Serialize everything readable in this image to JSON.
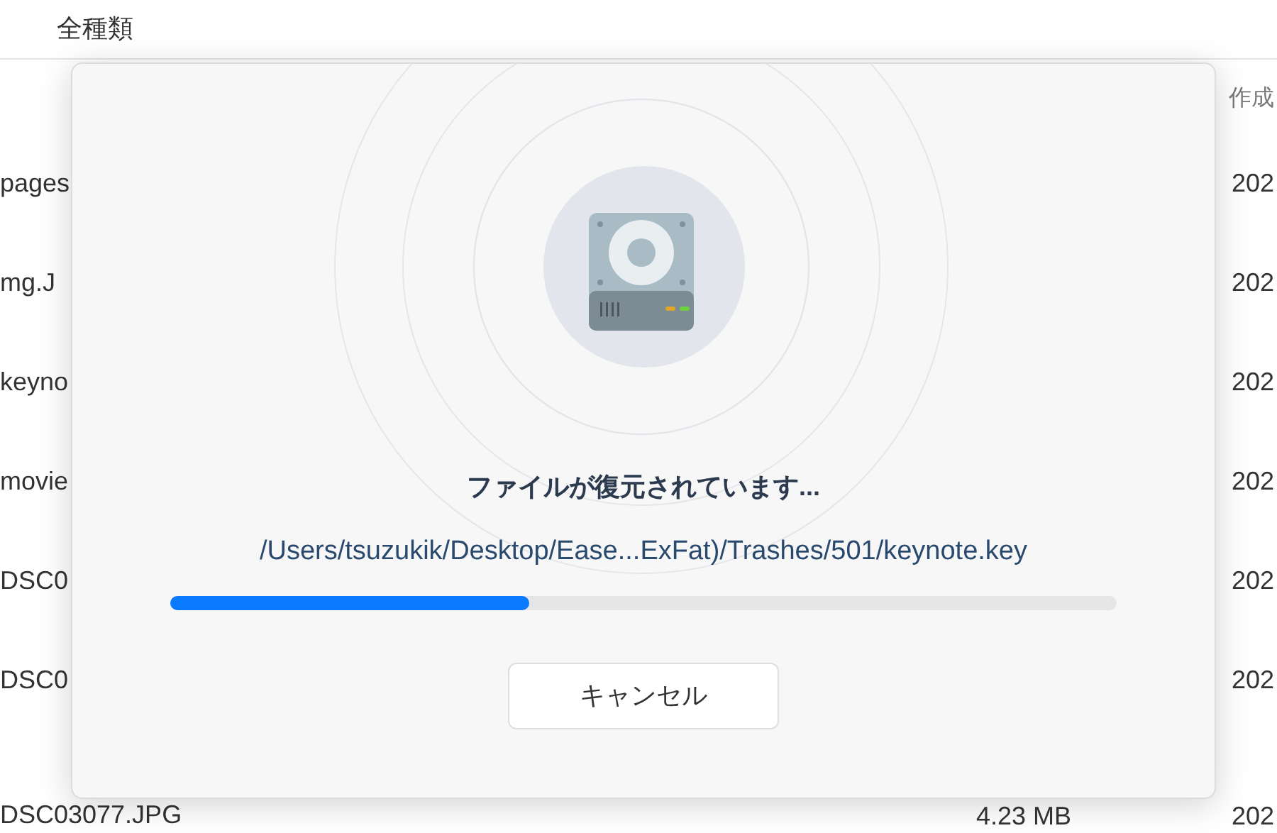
{
  "background": {
    "header_title": "全種類",
    "column_header": "作成",
    "rows": [
      {
        "name": "pages",
        "date": "202"
      },
      {
        "name": "mg.J",
        "date": "202"
      },
      {
        "name": "keyno",
        "date": "202"
      },
      {
        "name": "movie",
        "date": "202"
      },
      {
        "name": "DSC0",
        "date": "202"
      },
      {
        "name": "DSC0",
        "date": "202"
      },
      {
        "name": "DSC03077.JPG",
        "size": "4.23 MB",
        "date": "202"
      }
    ]
  },
  "dialog": {
    "title": "ファイルが復元されています...",
    "path": "/Users/tsuzukik/Desktop/Ease...ExFat)/Trashes/501/keynote.key",
    "progress": {
      "level": 0.38
    },
    "buttons": [
      "キャンセル"
    ]
  }
}
